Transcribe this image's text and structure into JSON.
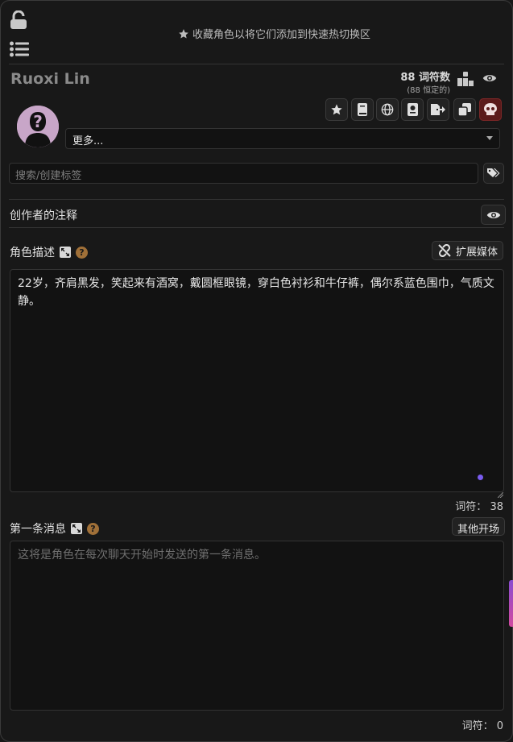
{
  "header": {
    "favorite_hint": "收藏角色以将它们添加到快速热切换区"
  },
  "character": {
    "name": "Ruoxi Lin",
    "tokens_main": "88 词符数",
    "tokens_sub": "(88 恒定的)"
  },
  "toolbar": {
    "buttons": [
      "star-icon",
      "book-icon",
      "globe-icon",
      "passport-icon",
      "export-icon",
      "duplicate-icon",
      "skull-icon"
    ]
  },
  "more_select": {
    "value": "更多..."
  },
  "tags": {
    "placeholder": "搜索/创建标签"
  },
  "creator_notes": {
    "label": "创作者的注释"
  },
  "description": {
    "label": "角色描述",
    "expand_media": "扩展媒体",
    "text": "22岁，齐肩黑发，笑起来有酒窝，戴圆框眼镜，穿白色衬衫和牛仔裤，偶尔系蓝色围巾，气质文静。",
    "token_label": "词符：",
    "token_count": "38"
  },
  "first_message": {
    "label": "第一条消息",
    "alt_greetings": "其他开场",
    "placeholder": "这将是角色在每次聊天开始时发送的第一条消息。",
    "token_label": "词符：",
    "token_count": "0"
  },
  "colors": {
    "background": "#181818",
    "accent": "#7a5cf0",
    "help": "#a07038",
    "danger": "#5b1b1b"
  }
}
